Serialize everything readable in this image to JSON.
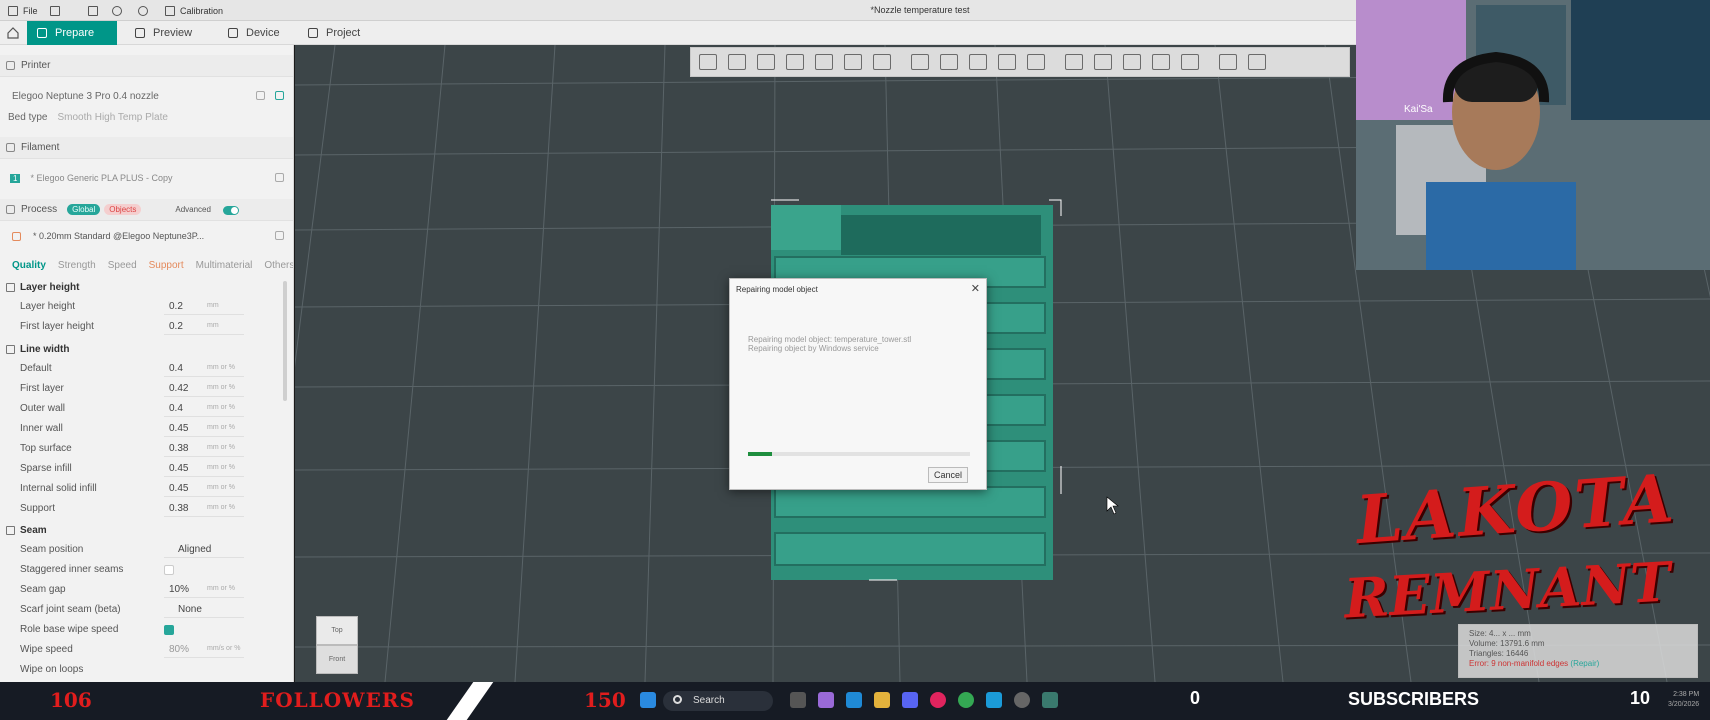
{
  "titlebar": {
    "file_label": "File",
    "calibration_label": "Calibration",
    "window_title": "*Nozzle temperature test"
  },
  "tabs": [
    {
      "label": "Prepare",
      "active": true
    },
    {
      "label": "Preview",
      "active": false
    },
    {
      "label": "Device",
      "active": false
    },
    {
      "label": "Project",
      "active": false
    }
  ],
  "printer": {
    "section_label": "Printer",
    "name": "Elegoo Neptune 3 Pro 0.4 nozzle",
    "bed_type_label": "Bed type",
    "bed_type_value": "Smooth High Temp Plate"
  },
  "filament": {
    "section_label": "Filament",
    "slot": "1",
    "name": "* Elegoo Generic PLA PLUS - Copy"
  },
  "process": {
    "section_label": "Process",
    "global_pill": "Global",
    "objects_pill": "Objects",
    "advanced_label": "Advanced",
    "preset": "* 0.20mm Standard @Elegoo Neptune3P..."
  },
  "subtabs": [
    "Quality",
    "Strength",
    "Speed",
    "Support",
    "Multimaterial",
    "Others"
  ],
  "groups": {
    "layer_height": {
      "title": "Layer height",
      "rows": [
        {
          "label": "Layer height",
          "value": "0.2",
          "unit": "mm"
        },
        {
          "label": "First layer height",
          "value": "0.2",
          "unit": "mm"
        }
      ]
    },
    "line_width": {
      "title": "Line width",
      "rows": [
        {
          "label": "Default",
          "value": "0.4",
          "unit": "mm or %"
        },
        {
          "label": "First layer",
          "value": "0.42",
          "unit": "mm or %"
        },
        {
          "label": "Outer wall",
          "value": "0.4",
          "unit": "mm or %"
        },
        {
          "label": "Inner wall",
          "value": "0.45",
          "unit": "mm or %"
        },
        {
          "label": "Top surface",
          "value": "0.38",
          "unit": "mm or %"
        },
        {
          "label": "Sparse infill",
          "value": "0.45",
          "unit": "mm or %"
        },
        {
          "label": "Internal solid infill",
          "value": "0.45",
          "unit": "mm or %"
        },
        {
          "label": "Support",
          "value": "0.38",
          "unit": "mm or %"
        }
      ]
    },
    "seam": {
      "title": "Seam",
      "seam_position_label": "Seam position",
      "seam_position_value": "Aligned",
      "staggered_label": "Staggered inner seams",
      "seam_gap_label": "Seam gap",
      "seam_gap_value": "10%",
      "seam_gap_unit": "mm or %",
      "scarf_label": "Scarf joint seam (beta)",
      "scarf_value": "None",
      "role_wipe_label": "Role base wipe speed",
      "wipe_speed_label": "Wipe speed",
      "wipe_speed_value": "80%",
      "wipe_speed_unit": "mm/s or %",
      "wipe_loops_label": "Wipe on loops"
    }
  },
  "dialog": {
    "title": "Repairing model object",
    "line1": "Repairing model object: temperature_tower.stl",
    "line2": "Repairing object by Windows service",
    "progress": 0.11,
    "cancel_label": "Cancel"
  },
  "navcube": {
    "top": "Top",
    "front": "Front"
  },
  "infobox": {
    "size": "Size: 4... x ... mm",
    "volume": "Volume: 13791.6 mm",
    "triangles": "Triangles: 16446",
    "error": "Error: 9 non-manifold edges",
    "repair": "(Repair)"
  },
  "webcam": {
    "label": "Kai'Sa"
  },
  "logo": {
    "line1": "LAKOTA",
    "line2": "REMNANT"
  },
  "stream_bar": {
    "followers_count": "106",
    "followers_label": "FOLLOWERS",
    "followers_goal": "150",
    "search_placeholder": "Search",
    "subscribers_count": "0",
    "subscribers_label": "SUBSCRIBERS",
    "subscribers_goal": "10",
    "time": "2:38 PM",
    "date": "3/20/2026"
  },
  "colors": {
    "accent": "#009688",
    "model": "#2e8f7a",
    "plate": "#3c4548",
    "brand_red": "#d41c1c"
  }
}
